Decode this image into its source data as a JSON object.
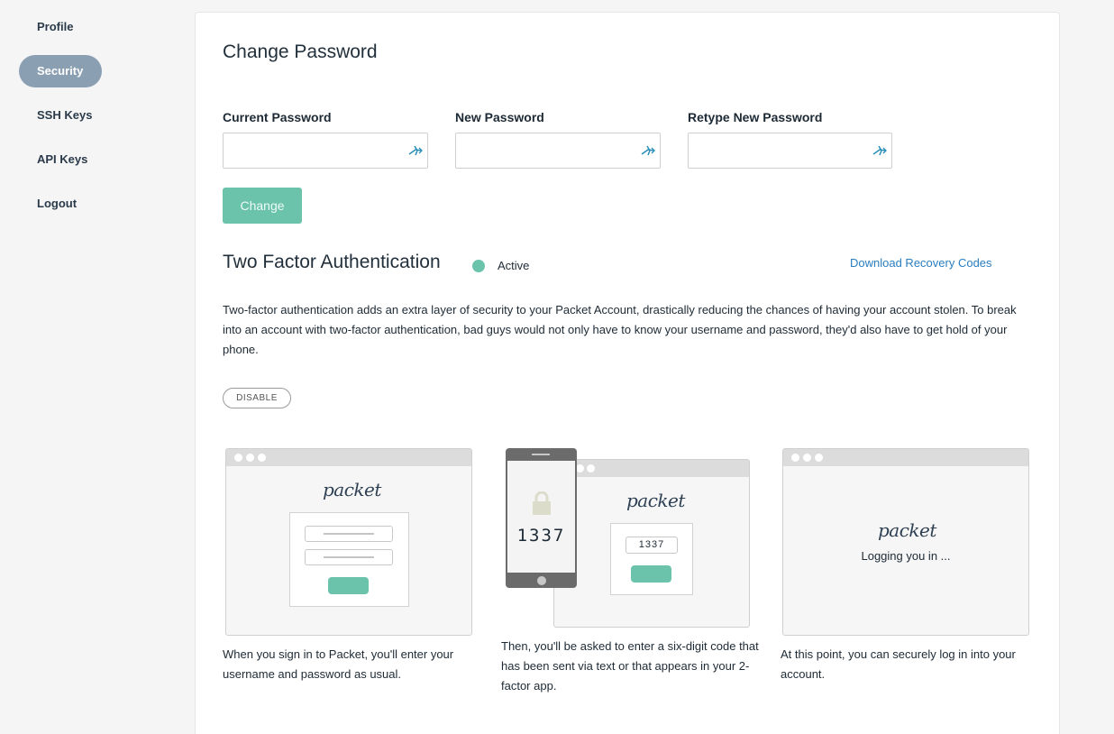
{
  "sidebar": {
    "items": [
      {
        "label": "Profile"
      },
      {
        "label": "Security"
      },
      {
        "label": "SSH Keys"
      },
      {
        "label": "API Keys"
      },
      {
        "label": "Logout"
      }
    ]
  },
  "change_password": {
    "title": "Change Password",
    "current_label": "Current Password",
    "new_label": "New Password",
    "retype_label": "Retype New Password",
    "current_value": "",
    "new_value": "",
    "retype_value": "",
    "change_button": "Change"
  },
  "two_factor": {
    "title": "Two Factor Authentication",
    "status": "Active",
    "download_link": "Download Recovery Codes",
    "description": "Two-factor authentication adds an extra layer of security to your Packet Account, drastically reducing the chances of having your account stolen. To break into an account with two-factor authentication, bad guys would not only have to know your username and password, they'd also have to get hold of your phone.",
    "disable_button": "DISABLE"
  },
  "illustrations": {
    "logo": "packet",
    "phone_code": "1337",
    "input_code": "1337",
    "logging_in": "Logging you in ...",
    "steps": [
      {
        "caption": "When you sign in to Packet, you'll enter your username and password as usual."
      },
      {
        "caption": "Then, you'll be asked to enter a six-digit code that has been sent via text or that appears in your 2-factor app."
      },
      {
        "caption": "At this point, you can securely log in into your account."
      }
    ]
  },
  "colors": {
    "accent": "#6cc3ab",
    "sidebar_active": "#8b9fb3",
    "link": "#2a7dbf"
  }
}
